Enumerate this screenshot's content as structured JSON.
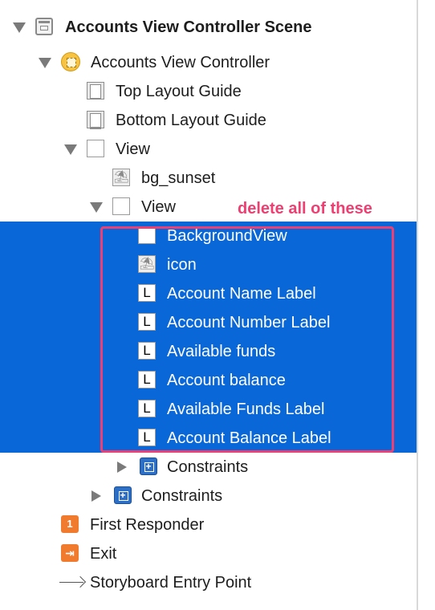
{
  "tree": {
    "scene": {
      "label": "Accounts View Controller Scene",
      "icon": "scene-icon"
    },
    "controller": {
      "label": "Accounts View Controller",
      "icon": "view-controller-icon"
    },
    "top_layout_guide": {
      "label": "Top Layout Guide",
      "icon": "layout-guide-icon"
    },
    "bottom_layout_guide": {
      "label": "Bottom Layout Guide",
      "icon": "layout-guide-icon"
    },
    "root_view": {
      "label": "View",
      "icon": "view-icon"
    },
    "bg_image": {
      "label": "bg_sunset",
      "icon": "image-view-icon"
    },
    "inner_view": {
      "label": "View",
      "icon": "view-icon"
    },
    "selected_items": [
      {
        "label": "BackgroundView",
        "icon": "view-icon"
      },
      {
        "label": "icon",
        "icon": "image-view-icon"
      },
      {
        "label": "Account Name Label",
        "icon": "label-icon"
      },
      {
        "label": "Account Number Label",
        "icon": "label-icon"
      },
      {
        "label": "Available funds",
        "icon": "label-icon"
      },
      {
        "label": "Account balance",
        "icon": "label-icon"
      },
      {
        "label": "Available Funds Label",
        "icon": "label-icon"
      },
      {
        "label": "Account Balance Label",
        "icon": "label-icon"
      }
    ],
    "inner_constraints": {
      "label": "Constraints",
      "icon": "constraints-icon"
    },
    "outer_constraints": {
      "label": "Constraints",
      "icon": "constraints-icon"
    },
    "first_responder": {
      "label": "First Responder",
      "icon": "first-responder-icon"
    },
    "exit": {
      "label": "Exit",
      "icon": "exit-icon"
    },
    "entry_point": {
      "label": "Storyboard Entry Point",
      "icon": "arrow-icon"
    }
  },
  "glyphs": {
    "label_glyph": "L",
    "image_glyph": "⛱",
    "responder_glyph": "1",
    "exit_glyph": "⇥"
  },
  "annotation": {
    "text": "delete all of these",
    "color": "#ee3f72"
  },
  "colors": {
    "selection": "#0a67d8",
    "annotation": "#ee3f72"
  }
}
